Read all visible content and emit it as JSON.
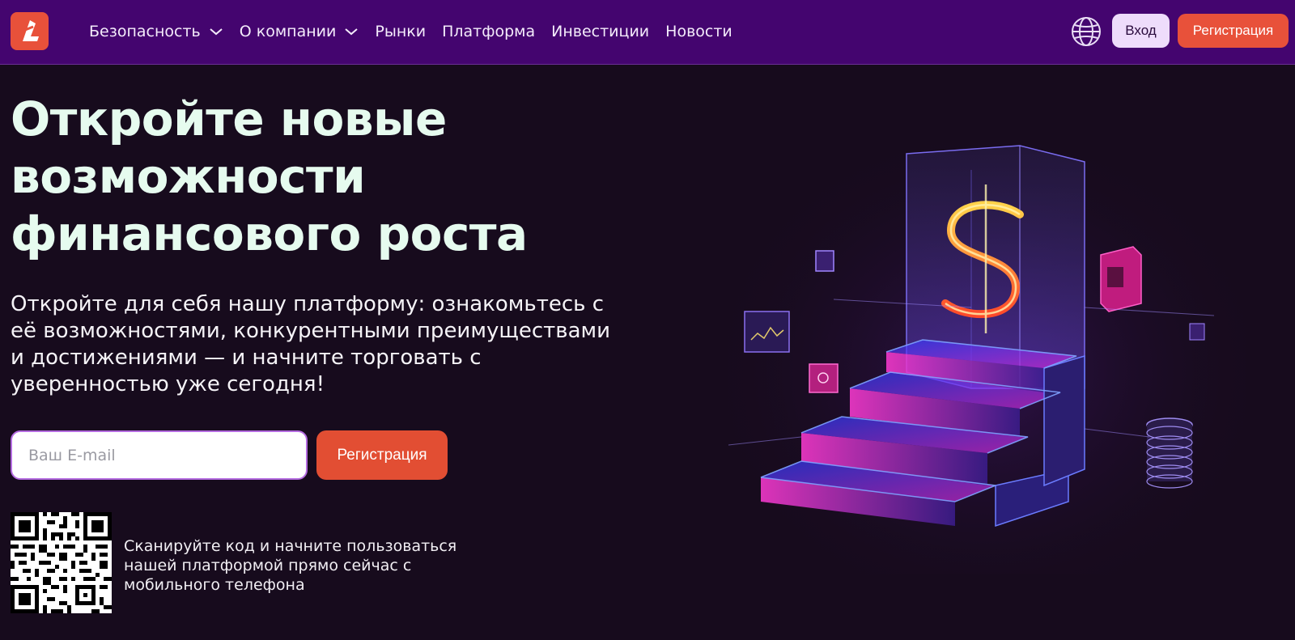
{
  "header": {
    "logo_icon": "brand-logo-icon",
    "nav": [
      {
        "label": "Безопасность",
        "has_dropdown": true
      },
      {
        "label": "О компании",
        "has_dropdown": true
      },
      {
        "label": "Рынки",
        "has_dropdown": false
      },
      {
        "label": "Платформа",
        "has_dropdown": false
      },
      {
        "label": "Инвестиции",
        "has_dropdown": false
      },
      {
        "label": "Новости",
        "has_dropdown": false
      }
    ],
    "language_icon": "globe-icon",
    "login_label": "Вход",
    "register_label": "Регистрация"
  },
  "hero": {
    "title_lines": [
      "Откройте новые",
      "возможности",
      "финансового роста"
    ],
    "subtitle_lines": [
      "Откройте для себя нашу платформу: ознакомьтесь с",
      "её возможностями, конкурентными преимуществами",
      "и достижениями — и начните торговать с",
      "уверенностью уже сегодня!"
    ],
    "email_placeholder": "Ваш E-mail",
    "register_button": "Регистрация"
  },
  "qr": {
    "text_lines": [
      "Сканируйте код и начните пользоваться",
      "нашей платформой прямо сейчас с",
      "мобильного телефона"
    ]
  },
  "colors": {
    "header_bg": "#44056f",
    "page_bg": "#170b1d",
    "accent": "#e8513a",
    "login_bg": "#eedcfb",
    "title_color": "#e6fbef"
  }
}
